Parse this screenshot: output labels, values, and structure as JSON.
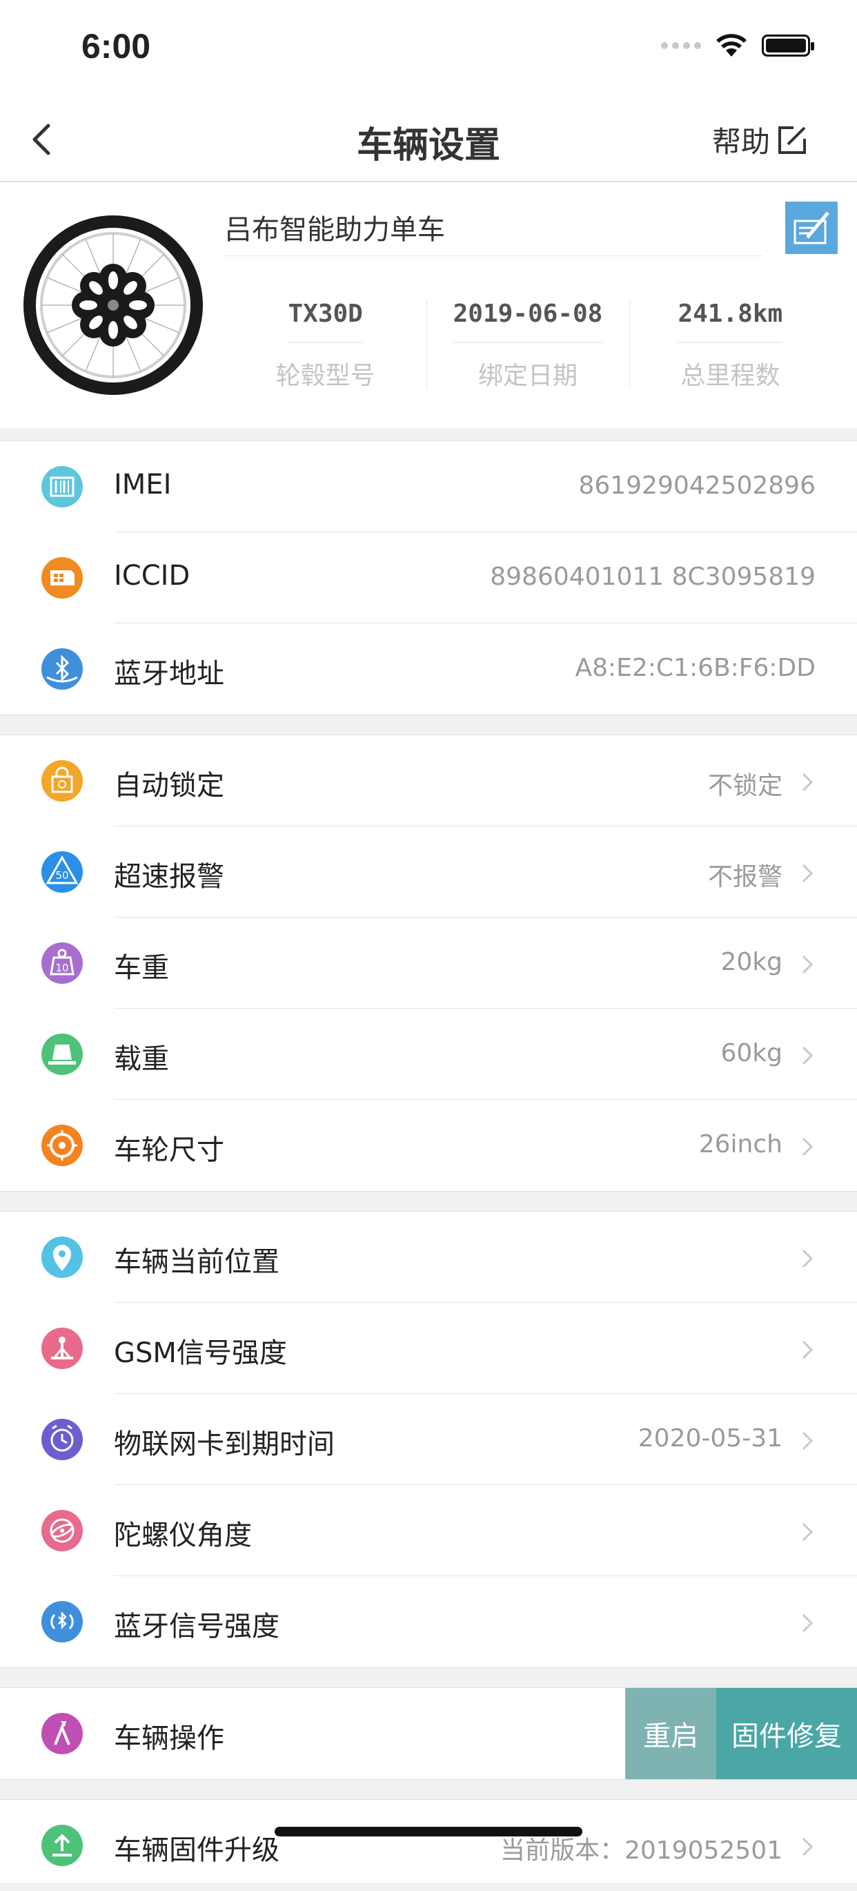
{
  "status_bar": {
    "time": "6:00"
  },
  "nav": {
    "title": "车辆设置",
    "help_label": "帮助"
  },
  "bike": {
    "name": "吕布智能助力单车",
    "stats": [
      {
        "value": "TX30D",
        "label": "轮毂型号"
      },
      {
        "value": "2019-06-08",
        "label": "绑定日期"
      },
      {
        "value": "241.8km",
        "label": "总里程数"
      }
    ]
  },
  "info": [
    {
      "icon": "barcode-icon",
      "color": "#5cc7dc",
      "label": "IMEI",
      "value": "861929042502896"
    },
    {
      "icon": "sim-card-icon",
      "color": "#f18a1f",
      "label": "ICCID",
      "value": "89860401011 8C3095819"
    },
    {
      "icon": "bluetooth-icon",
      "color": "#3f8fdd",
      "label": "蓝牙地址",
      "value": "A8:E2:C1:6B:F6:DD"
    }
  ],
  "settings": [
    {
      "icon": "lock-icon",
      "color": "#f4a629",
      "label": "自动锁定",
      "value": "不锁定"
    },
    {
      "icon": "speed-limit-icon",
      "color": "#2a8fe6",
      "label": "超速报警",
      "value": "不报警"
    },
    {
      "icon": "weight-icon",
      "color": "#a66fcf",
      "label": "车重",
      "value": "20kg"
    },
    {
      "icon": "load-icon",
      "color": "#4fc27a",
      "label": "载重",
      "value": "60kg"
    },
    {
      "icon": "wheel-size-icon",
      "color": "#f58220",
      "label": "车轮尺寸",
      "value": "26inch"
    }
  ],
  "status": [
    {
      "icon": "location-icon",
      "color": "#54c2e4",
      "label": "车辆当前位置",
      "value": ""
    },
    {
      "icon": "signal-icon",
      "color": "#e96a8a",
      "label": "GSM信号强度",
      "value": ""
    },
    {
      "icon": "clock-icon",
      "color": "#6a5fcf",
      "label": "物联网卡到期时间",
      "value": "2020-05-31"
    },
    {
      "icon": "gyroscope-icon",
      "color": "#e86a8c",
      "label": "陀螺仪角度",
      "value": ""
    },
    {
      "icon": "bluetooth-signal-icon",
      "color": "#3f8fdd",
      "label": "蓝牙信号强度",
      "value": ""
    }
  ],
  "operation": {
    "icon": "tools-icon",
    "color": "#c04fb5",
    "label": "车辆操作",
    "restart_label": "重启",
    "repair_label": "固件修复"
  },
  "upgrade": {
    "icon": "upgrade-icon",
    "color": "#4fc27a",
    "label": "车辆固件升级",
    "value": "当前版本：2019052501"
  }
}
